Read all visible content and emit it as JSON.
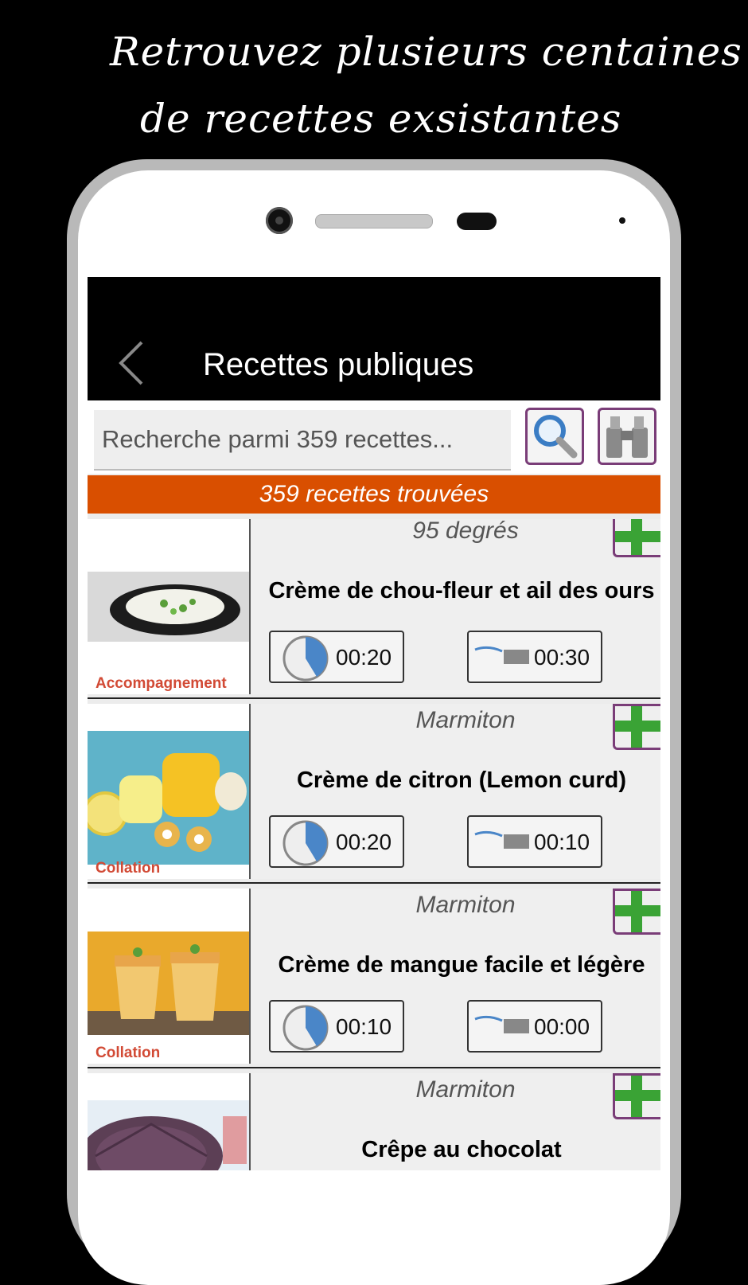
{
  "promo": {
    "line1": "Retrouvez plusieurs centaines",
    "line2": "de recettes exsistantes"
  },
  "header": {
    "title": "Recettes publiques",
    "back_icon": "chevron-left-icon"
  },
  "search": {
    "placeholder": "Recherche parmi 359 recettes...",
    "search_icon": "magnifier-icon",
    "advanced_icon": "binoculars-icon"
  },
  "banner": {
    "text": "359 recettes trouvées"
  },
  "colors": {
    "banner": "#d94f00",
    "accent_border": "#7a3d78",
    "category": "#d24a35",
    "plus": "#3aa335",
    "timer": "#4a86c8"
  },
  "recipes": [
    {
      "source": "95 degrés",
      "title": "Crème de chou-fleur et ail des ours",
      "category": "Accompagnement",
      "prep_time": "00:20",
      "cook_time": "00:30"
    },
    {
      "source": "Marmiton",
      "title": "Crème de citron (Lemon curd)",
      "category": "Collation",
      "prep_time": "00:20",
      "cook_time": "00:10"
    },
    {
      "source": "Marmiton",
      "title": "Crème de mangue facile et légère",
      "category": "Collation",
      "prep_time": "00:10",
      "cook_time": "00:00"
    },
    {
      "source": "Marmiton",
      "title": "Crêpe au chocolat",
      "category": "",
      "prep_time": "",
      "cook_time": ""
    }
  ]
}
